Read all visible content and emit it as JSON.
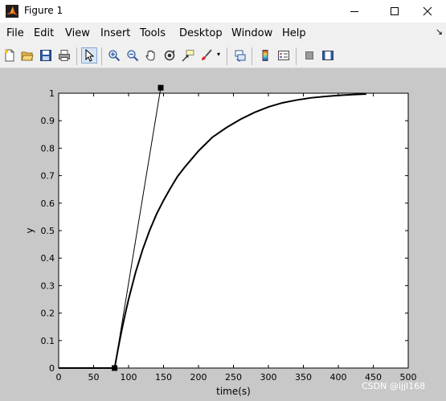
{
  "window": {
    "title": "Figure 1"
  },
  "menu": [
    "File",
    "Edit",
    "View",
    "Insert",
    "Tools",
    "Desktop",
    "Window",
    "Help"
  ],
  "toolbar_icons": [
    "new-figure-icon",
    "open-file-icon",
    "save-icon",
    "print-icon",
    "edit-plot-arrow-icon",
    "zoom-in-icon",
    "zoom-out-icon",
    "pan-hand-icon",
    "rotate-3d-icon",
    "data-cursor-icon",
    "brush-icon",
    "link-plot-icon",
    "colorbar-icon",
    "legend-icon",
    "hide-plot-tools-icon",
    "show-plot-tools-icon"
  ],
  "watermark": "CSDN @ljjl168",
  "chart_data": {
    "type": "line",
    "title": "",
    "xlabel": "time(s)",
    "ylabel": "y",
    "xlim": [
      0,
      500
    ],
    "ylim": [
      0,
      1
    ],
    "xticks": [
      0,
      50,
      100,
      150,
      200,
      250,
      300,
      350,
      400,
      450,
      500
    ],
    "yticks": [
      0,
      0.1,
      0.2,
      0.3,
      0.4,
      0.5,
      0.6,
      0.7,
      0.8,
      0.9,
      1
    ],
    "xtick_labels": [
      "0",
      "50",
      "100",
      "150",
      "200",
      "250",
      "300",
      "350",
      "400",
      "450",
      "500"
    ],
    "ytick_labels": [
      "0",
      "0.1",
      "0.2",
      "0.3",
      "0.4",
      "0.5",
      "0.6",
      "0.7",
      "0.8",
      "0.9",
      "1"
    ],
    "grid": false,
    "series": [
      {
        "x": [
          0,
          80,
          85,
          90,
          95,
          100,
          110,
          120,
          130,
          140,
          150,
          160,
          170,
          180,
          190,
          200,
          220,
          240,
          260,
          280,
          300,
          320,
          340,
          360,
          380,
          400,
          420,
          440
        ],
        "y": [
          0,
          0,
          0.07,
          0.135,
          0.195,
          0.25,
          0.348,
          0.43,
          0.5,
          0.56,
          0.61,
          0.655,
          0.697,
          0.73,
          0.76,
          0.79,
          0.84,
          0.875,
          0.905,
          0.93,
          0.95,
          0.965,
          0.975,
          0.983,
          0.988,
          0.992,
          0.995,
          0.997
        ],
        "color": "#000000"
      },
      {
        "x": [
          80,
          146
        ],
        "y": [
          0,
          1.02
        ],
        "color": "#000000"
      }
    ],
    "markers": [
      {
        "x": 80,
        "y": 0
      },
      {
        "x": 146,
        "y": 1.02
      }
    ]
  }
}
